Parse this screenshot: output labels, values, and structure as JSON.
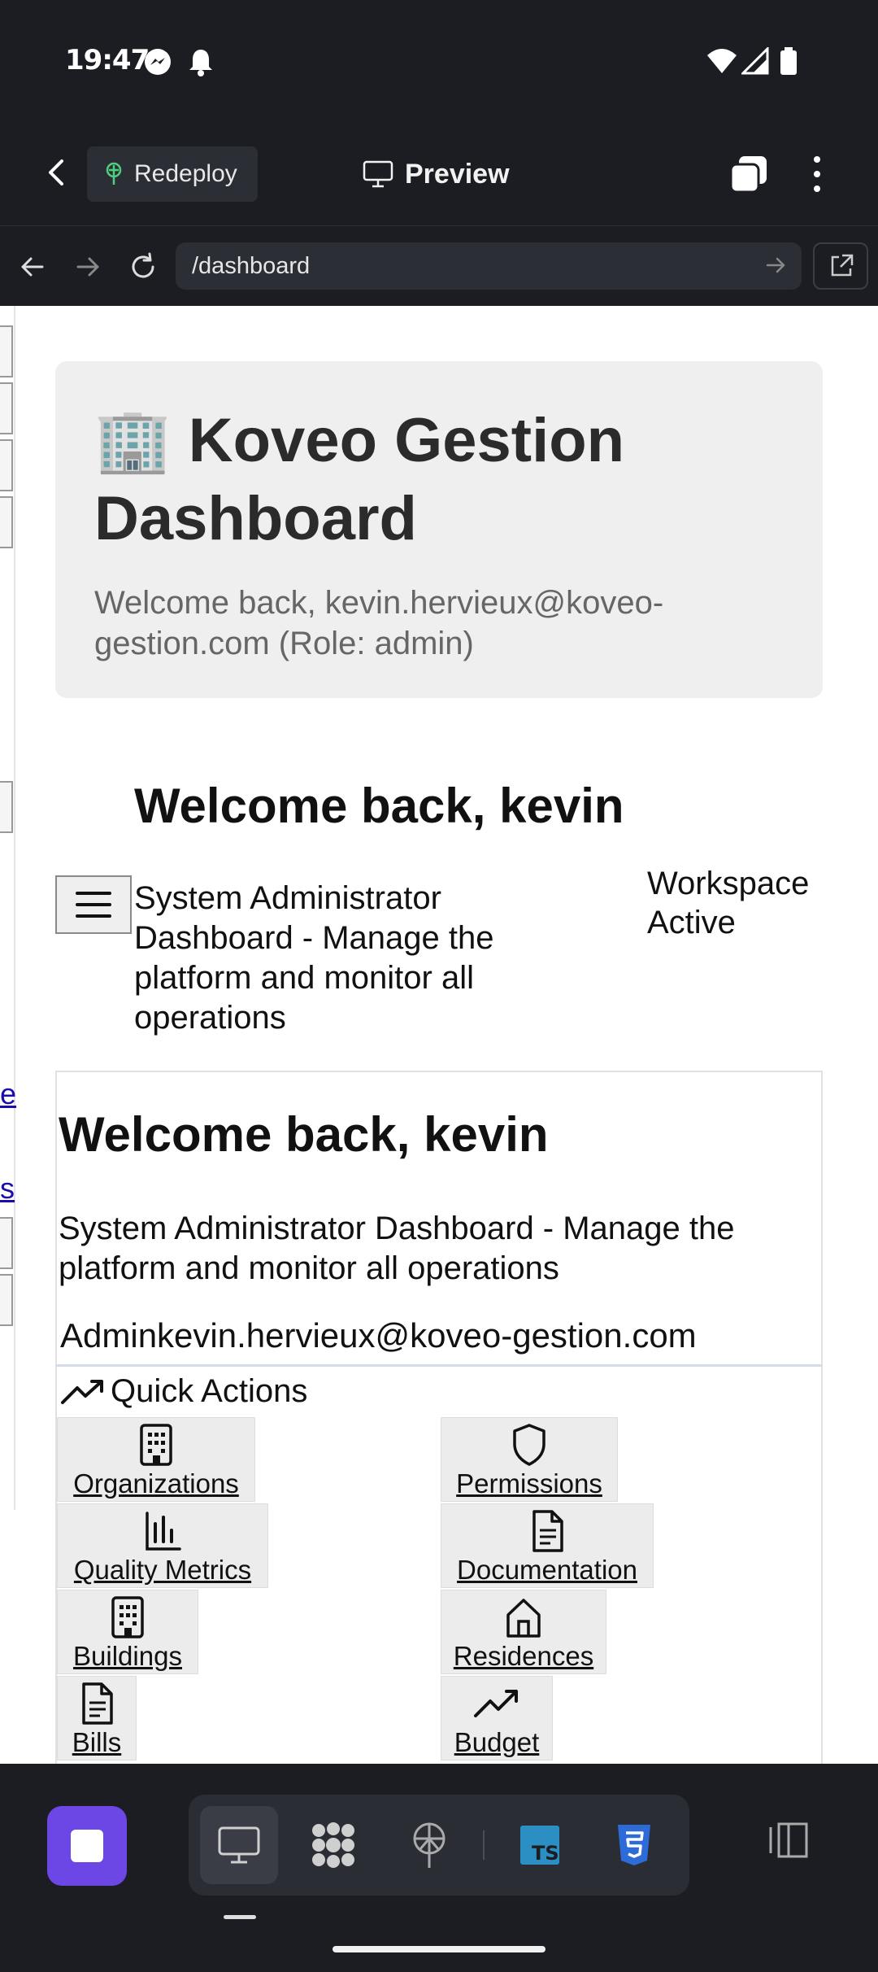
{
  "status_bar": {
    "time": "19:47"
  },
  "app_bar": {
    "redeploy_label": "Redeploy",
    "preview_label": "Preview"
  },
  "url_bar": {
    "url": "/dashboard"
  },
  "page": {
    "hero": {
      "title": "🏢 Koveo Gestion Dashboard",
      "subtitle": "Welcome back, kevin.hervieux@koveo-gestion.com (Role: admin)"
    },
    "header": {
      "welcome": "Welcome back, kevin",
      "subtitle": "System Administrator Dashboard - Manage the platform and monitor all operations",
      "workspace_status": "Workspace Active"
    },
    "card": {
      "welcome": "Welcome back, kevin",
      "description": "System Administrator Dashboard - Manage the platform and monitor all operations",
      "user": "Adminkevin.hervieux@koveo-gestion.com"
    },
    "quick_actions": {
      "title": "Quick Actions",
      "items": [
        {
          "label": "Organizations",
          "icon": "building-icon"
        },
        {
          "label": "Permissions",
          "icon": "shield-icon"
        },
        {
          "label": "Quality Metrics",
          "icon": "bar-chart-icon"
        },
        {
          "label": "Documentation",
          "icon": "document-icon"
        },
        {
          "label": "Buildings",
          "icon": "building-icon"
        },
        {
          "label": "Residences",
          "icon": "home-icon"
        },
        {
          "label": "Bills",
          "icon": "document-icon"
        },
        {
          "label": "Budget",
          "icon": "trending-up-icon"
        }
      ]
    },
    "side_rail_links": [
      "e",
      "s"
    ]
  },
  "colors": {
    "accent": "#6c47e6",
    "link": "#1a0dab",
    "chrome": "#1b1d22"
  }
}
